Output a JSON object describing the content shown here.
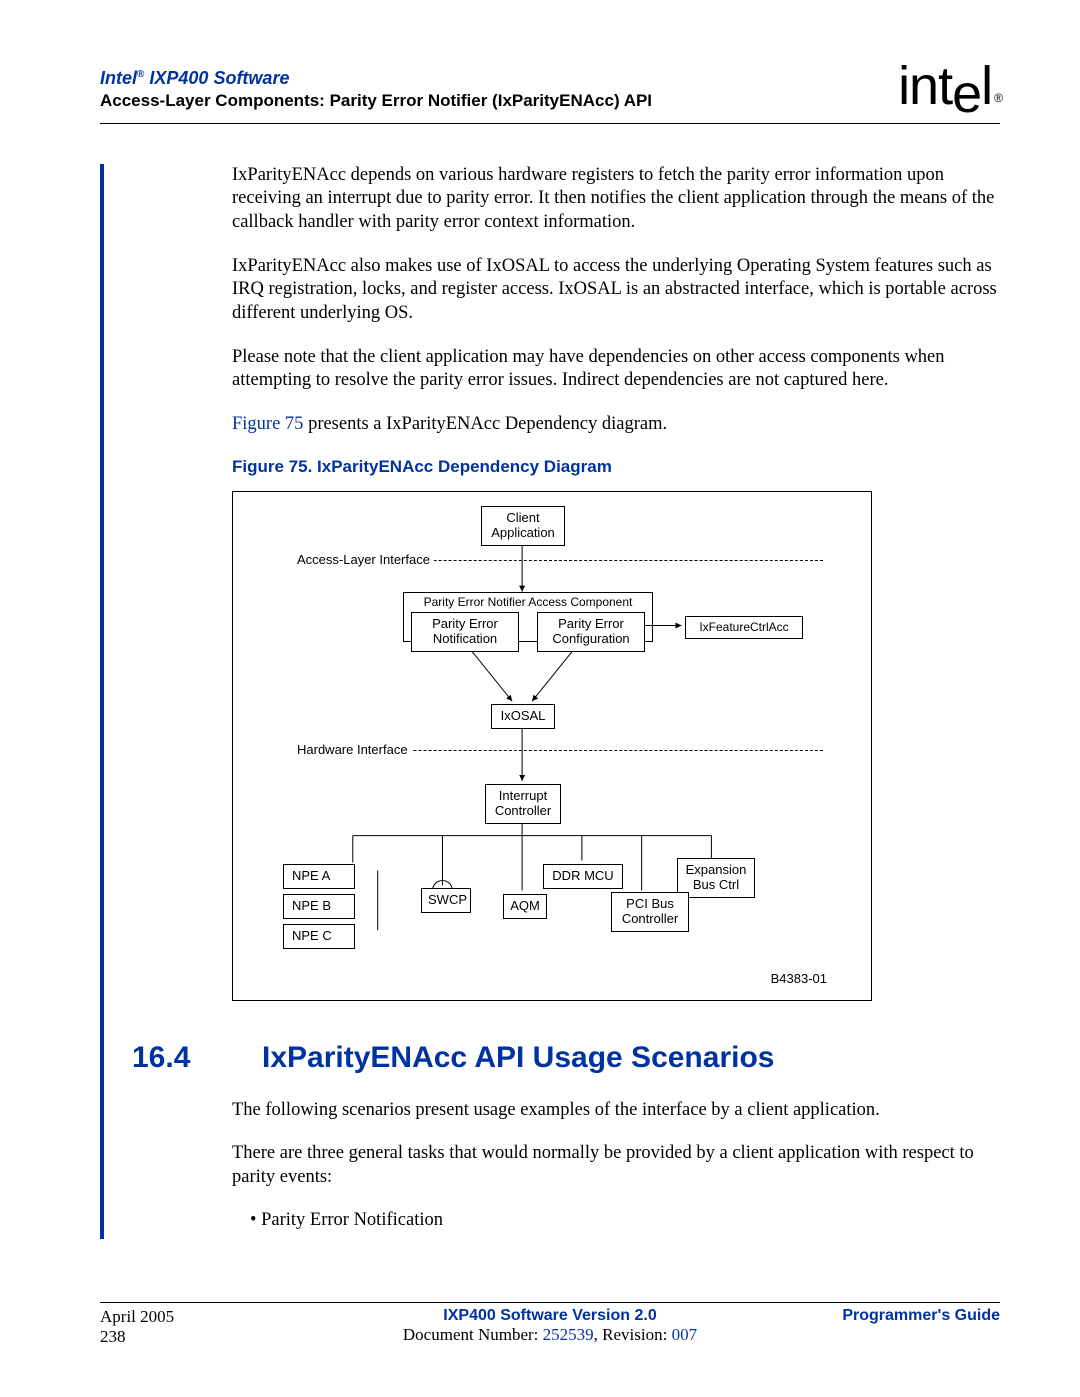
{
  "header": {
    "product": "Intel",
    "product_reg": "®",
    "product_suffix": " IXP400 Software",
    "subtitle": "Access-Layer Components: Parity Error Notifier (IxParityENAcc) API",
    "logo_text": "intel",
    "logo_reg": "®"
  },
  "body": {
    "p1": "IxParityENAcc depends on various hardware registers to fetch the parity error information upon receiving an interrupt due to parity error. It then notifies the client application through the means of the callback handler with parity error context information.",
    "p2": "IxParityENAcc also makes use of IxOSAL to access the underlying Operating System features such as IRQ registration, locks, and register access. IxOSAL is an abstracted interface, which is portable across different underlying OS.",
    "p3": "Please note that the client application may have dependencies on other access components when attempting to resolve the parity error issues. Indirect dependencies are not captured here.",
    "p4_link": "Figure 75",
    "p4_rest": " presents a IxParityENAcc Dependency diagram.",
    "fig_caption": "Figure 75. IxParityENAcc Dependency Diagram",
    "section_num": "16.4",
    "section_title": "IxParityENAcc API Usage Scenarios",
    "p5": "The following scenarios present usage examples of the interface by a client application.",
    "p6": "There are three general tasks that would normally be provided by a client application with respect to parity events:",
    "bullet1": "•  Parity Error Notification"
  },
  "diagram": {
    "client": "Client\nApplication",
    "access_layer": "Access-Layer Interface",
    "notifier_group": "Parity Error Notifier Access Component",
    "pe_notification": "Parity Error\nNotification",
    "pe_config": "Parity Error\nConfiguration",
    "ixfeature": "IxFeatureCtrlAcc",
    "ixosal": "IxOSAL",
    "hw_interface": "Hardware Interface",
    "interrupt": "Interrupt\nController",
    "npe_a": "NPE A",
    "npe_b": "NPE B",
    "npe_c": "NPE C",
    "swcp": "SWCP",
    "ddr": "DDR MCU",
    "aqm": "AQM",
    "expansion": "Expansion\nBus Ctrl",
    "pci": "PCI Bus\nController",
    "id": "B4383-01"
  },
  "footer": {
    "date": "April 2005",
    "page": "238",
    "center_bold": "IXP400 Software Version 2.0",
    "doc_label": "Document Number: ",
    "doc_num": "252539",
    "rev_label": ", Revision: ",
    "rev_num": "007",
    "right": "Programmer's Guide"
  }
}
